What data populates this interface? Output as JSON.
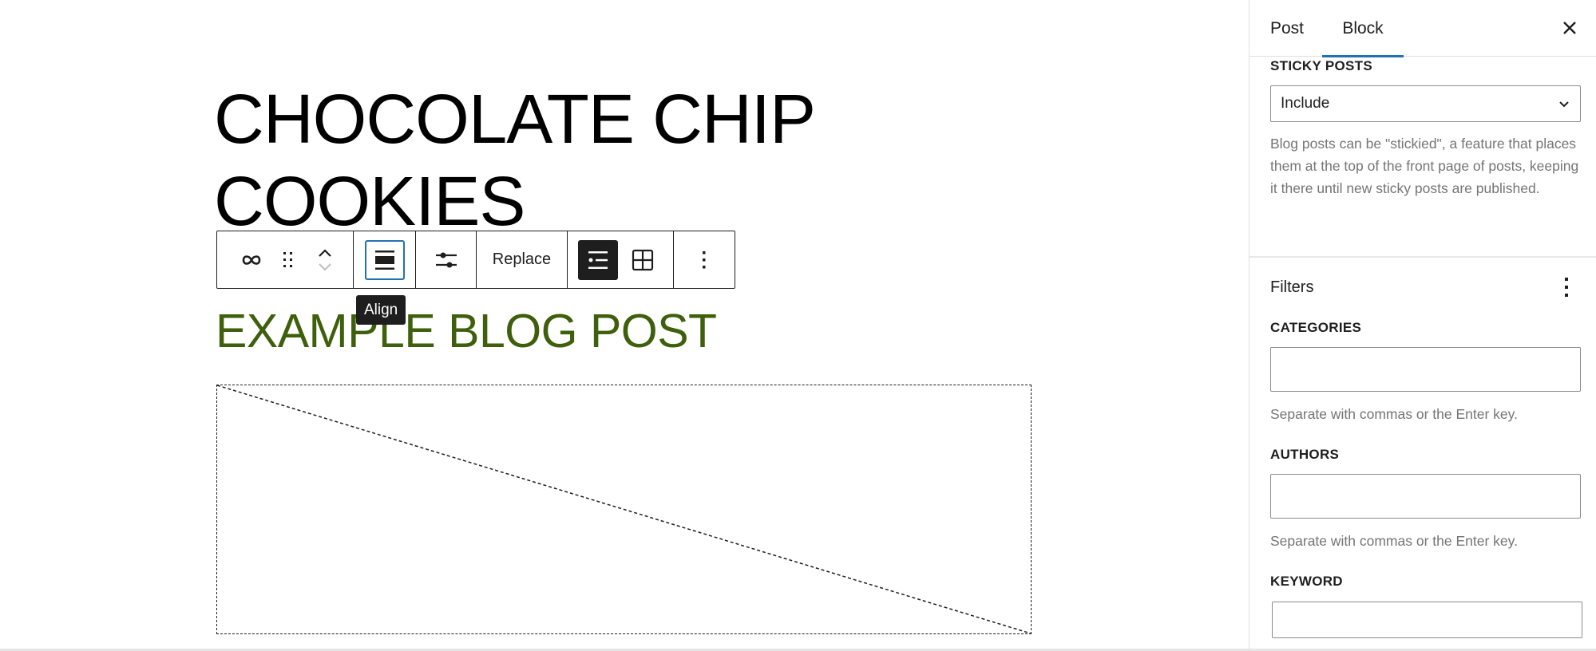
{
  "editor": {
    "post_title": "CHOCOLATE CHIP COOKIES",
    "heading": "EXAMPLE BLOG POST",
    "heading_color": "#3e5f0b",
    "toolbar": {
      "transform_icon": "infinity-loop-icon",
      "drag_icon": "drag-handle-icon",
      "move_up_icon": "chevron-up-icon",
      "move_down_icon": "chevron-down-icon",
      "align_icon": "align-none-icon",
      "settings_icon": "sliders-icon",
      "replace_label": "Replace",
      "layout_list_icon": "list-view-icon",
      "layout_grid_icon": "grid-view-icon",
      "options_icon": "more-vertical-icon"
    },
    "tooltip": "Align",
    "accent_color": "#2271b1"
  },
  "sidebar": {
    "tabs": [
      {
        "label": "Post",
        "active": false
      },
      {
        "label": "Block",
        "active": true
      }
    ],
    "close_label": "Close",
    "sticky_posts": {
      "label": "STICKY POSTS",
      "selected": "Include",
      "help": "Blog posts can be \"stickied\", a feature that places them at the top of the front page of posts, keeping it there until new sticky posts are published."
    },
    "filters": {
      "title": "Filters",
      "categories": {
        "label": "CATEGORIES",
        "value": "",
        "help": "Separate with commas or the Enter key."
      },
      "authors": {
        "label": "AUTHORS",
        "value": "",
        "help": "Separate with commas or the Enter key."
      },
      "keyword": {
        "label": "KEYWORD",
        "value": ""
      }
    }
  }
}
